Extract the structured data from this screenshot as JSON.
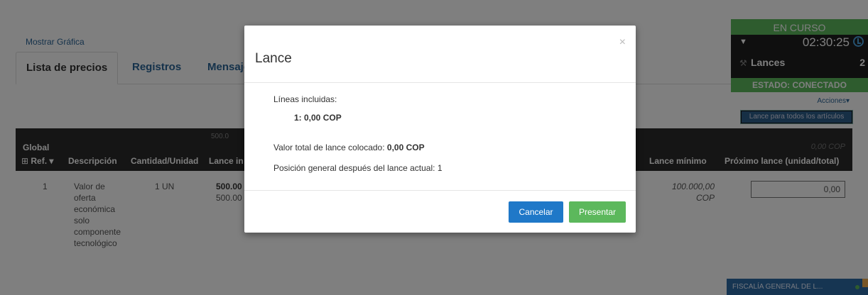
{
  "page": {
    "show_chart": "Mostrar Gráfica",
    "tabs": [
      "Lista de precios",
      "Registros",
      "Mensaje"
    ],
    "table": {
      "global_label": "Global",
      "header_value": "500.0",
      "global_total": "0,00 COP",
      "columns": {
        "ref": "Ref.",
        "description": "Descripción",
        "quantity": "Cantidad/Unidad",
        "initial_bid": "Lance in",
        "min_bid": "Lance mínimo",
        "next_bid": "Próximo lance (unidad/total)"
      },
      "row": {
        "ref": "1",
        "description": [
          "Valor de",
          "oferta",
          "económica",
          "solo",
          "componente",
          "tecnológico"
        ],
        "quantity": "1 UN",
        "initial_bid_1": "500.00",
        "initial_bid_2": "500.00",
        "min_bid_1": "100.000,00",
        "min_bid_2": "COP",
        "next_bid_value": "0,00"
      }
    }
  },
  "side": {
    "status": "EN CURSO",
    "timer": "02:30:25",
    "bids_label": "Lances",
    "bids_count": "2",
    "state": "ESTADO: CONECTADO",
    "actions": "Acciones",
    "bid_all": "Lance para todos los artículos",
    "org": "FISCALÍA GENERAL DE L..."
  },
  "modal": {
    "title": "Lance",
    "close": "×",
    "lines_label": "Líneas incluidas:",
    "line_item": "1: 0,00 COP",
    "total_label": "Valor total de lance colocado: ",
    "total_value": "0,00 COP",
    "position": "Posición general después del lance actual: 1",
    "cancel": "Cancelar",
    "submit": "Presentar"
  },
  "colors": {
    "green": "#5cb85c",
    "blue": "#1f78c8",
    "dark": "#2b2b2b"
  }
}
